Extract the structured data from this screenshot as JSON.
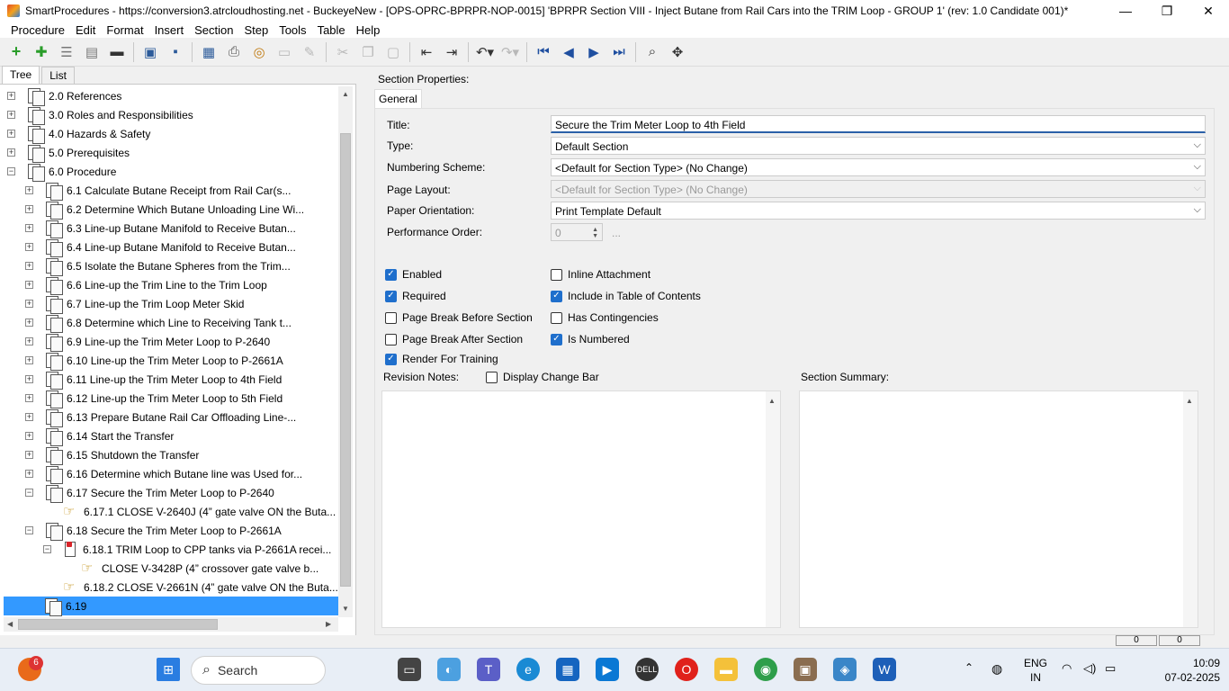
{
  "window": {
    "title": "SmartProcedures - https://conversion3.atrcloudhosting.net - BuckeyeNew - [OPS-OPRC-BPRPR-NOP-0015] 'BPRPR Section VIII - Inject Butane from Rail Cars into the TRIM Loop - GROUP 1' (rev: 1.0 Candidate 001)*",
    "minimize": "—",
    "restore": "❐",
    "close": "✕"
  },
  "menu": [
    "Procedure",
    "Edit",
    "Format",
    "Insert",
    "Section",
    "Step",
    "Tools",
    "Table",
    "Help"
  ],
  "left_tabs": [
    "Tree",
    "List"
  ],
  "tree": [
    {
      "label": "2.0 References",
      "level": 0,
      "expander": "+",
      "icon": "doc"
    },
    {
      "label": "3.0 Roles and Responsibilities",
      "level": 0,
      "expander": "+",
      "icon": "doc"
    },
    {
      "label": "4.0 Hazards & Safety",
      "level": 0,
      "expander": "+",
      "icon": "doc"
    },
    {
      "label": "5.0 Prerequisites",
      "level": 0,
      "expander": "+",
      "icon": "doc"
    },
    {
      "label": "6.0 Procedure",
      "level": 0,
      "expander": "−",
      "icon": "doc"
    },
    {
      "label": "6.1 Calculate Butane Receipt from Rail Car(s...",
      "level": 1,
      "expander": "+",
      "icon": "doc"
    },
    {
      "label": "6.2 Determine Which Butane Unloading Line Wi...",
      "level": 1,
      "expander": "+",
      "icon": "doc"
    },
    {
      "label": "6.3 Line-up Butane Manifold to Receive Butan...",
      "level": 1,
      "expander": "+",
      "icon": "doc"
    },
    {
      "label": "6.4 Line-up Butane Manifold to Receive Butan...",
      "level": 1,
      "expander": "+",
      "icon": "doc"
    },
    {
      "label": "6.5 Isolate the Butane Spheres from the Trim...",
      "level": 1,
      "expander": "+",
      "icon": "doc"
    },
    {
      "label": "6.6 Line-up the Trim Line to the Trim Loop",
      "level": 1,
      "expander": "+",
      "icon": "doc"
    },
    {
      "label": "6.7 Line-up the Trim Loop Meter Skid",
      "level": 1,
      "expander": "+",
      "icon": "doc"
    },
    {
      "label": "6.8 Determine which Line to Receiving Tank t...",
      "level": 1,
      "expander": "+",
      "icon": "doc"
    },
    {
      "label": "6.9 Line-up the Trim Meter Loop to P-2640",
      "level": 1,
      "expander": "+",
      "icon": "doc"
    },
    {
      "label": "6.10 Line-up the Trim Meter Loop to P-2661A",
      "level": 1,
      "expander": "+",
      "icon": "doc"
    },
    {
      "label": "6.11 Line-up the Trim Meter Loop to 4th Field",
      "level": 1,
      "expander": "+",
      "icon": "doc"
    },
    {
      "label": "6.12 Line-up the Trim Meter Loop to 5th Field",
      "level": 1,
      "expander": "+",
      "icon": "doc"
    },
    {
      "label": "6.13 Prepare Butane Rail Car Offloading Line-...",
      "level": 1,
      "expander": "+",
      "icon": "doc"
    },
    {
      "label": "6.14 Start the Transfer",
      "level": 1,
      "expander": "+",
      "icon": "doc"
    },
    {
      "label": "6.15 Shutdown the Transfer",
      "level": 1,
      "expander": "+",
      "icon": "doc"
    },
    {
      "label": "6.16 Determine which Butane line was Used for...",
      "level": 1,
      "expander": "+",
      "icon": "doc"
    },
    {
      "label": "6.17 Secure the Trim Meter Loop to P-2640",
      "level": 1,
      "expander": "−",
      "icon": "doc"
    },
    {
      "label": "6.17.1 CLOSE V-2640J (4” gate valve ON the Buta...",
      "level": 2,
      "expander": "",
      "icon": "hand"
    },
    {
      "label": "6.18 Secure the Trim Meter Loop to P-2661A",
      "level": 1,
      "expander": "−",
      "icon": "doc"
    },
    {
      "label": "6.18.1 TRIM Loop to CPP tanks via P-2661A recei...",
      "level": 2,
      "expander": "−",
      "icon": "red"
    },
    {
      "label": "CLOSE V-3428P (4” crossover gate valve b...",
      "level": 3,
      "expander": "",
      "icon": "hand"
    },
    {
      "label": "6.18.2 CLOSE V-2661N (4” gate valve ON the Buta...",
      "level": 2,
      "expander": "",
      "icon": "hand"
    },
    {
      "label": "6.19",
      "level": 1,
      "expander": "",
      "icon": "doc",
      "selected": true
    }
  ],
  "section_properties": {
    "heading": "Section Properties:",
    "tab": "General",
    "title_label": "Title:",
    "title_value": "Secure the Trim Meter Loop to 4th Field",
    "type_label": "Type:",
    "type_value": "Default Section",
    "numbering_label": "Numbering Scheme:",
    "numbering_value": "<Default for Section Type> (No Change)",
    "layout_label": "Page Layout:",
    "layout_value": "<Default for Section Type> (No Change)",
    "orientation_label": "Paper Orientation:",
    "orientation_value": "Print Template Default",
    "perf_label": "Performance Order:",
    "perf_value": "0",
    "perf_btn": "...",
    "checkboxes": [
      {
        "label": "Enabled",
        "checked": true
      },
      {
        "label": "Inline Attachment",
        "checked": false
      },
      {
        "label": "Required",
        "checked": true
      },
      {
        "label": "Include in Table of Contents",
        "checked": true
      },
      {
        "label": "Page Break Before Section",
        "checked": false
      },
      {
        "label": "Has Contingencies",
        "checked": false
      },
      {
        "label": "Page Break After Section",
        "checked": false
      },
      {
        "label": "Is Numbered",
        "checked": true
      },
      {
        "label": "Render For Training",
        "checked": true
      }
    ],
    "revision_label": "Revision Notes:",
    "display_change_bar": "Display Change Bar",
    "summary_label": "Section Summary:"
  },
  "status": {
    "page_a": "0",
    "page_b": "0"
  },
  "taskbar": {
    "search": "Search",
    "lang_top": "ENG",
    "lang_bottom": "IN",
    "time": "10:09",
    "date": "07-02-2025",
    "badge": "6"
  }
}
